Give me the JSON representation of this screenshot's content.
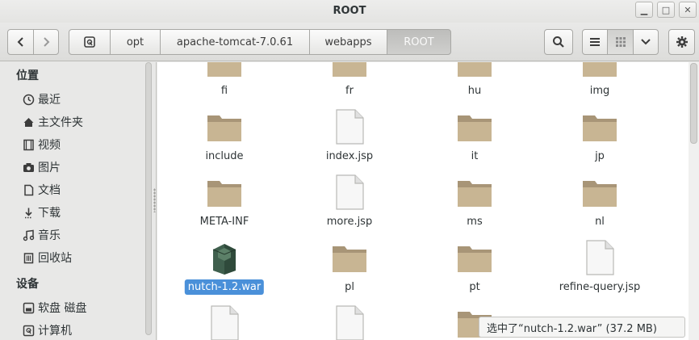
{
  "window": {
    "title": "ROOT",
    "buttons": [
      "minimize",
      "maximize",
      "close"
    ]
  },
  "toolbar": {
    "back_icon": "chevron-left-icon",
    "forward_icon": "chevron-right-icon",
    "breadcrumb": [
      "opt",
      "apache-tomcat-7.0.61",
      "webapps",
      "ROOT"
    ],
    "search_icon": "search-icon",
    "view_list_icon": "list-view-icon",
    "view_grid_icon": "grid-view-icon",
    "menu_icon": "chevron-down-icon",
    "settings_icon": "gear-icon"
  },
  "sidebar": {
    "places_heading": "位置",
    "places": [
      {
        "label": "最近",
        "icon": "clock-icon"
      },
      {
        "label": "主文件夹",
        "icon": "home-icon"
      },
      {
        "label": "视频",
        "icon": "film-icon"
      },
      {
        "label": "图片",
        "icon": "camera-icon"
      },
      {
        "label": "文档",
        "icon": "document-icon"
      },
      {
        "label": "下载",
        "icon": "download-icon"
      },
      {
        "label": "音乐",
        "icon": "music-icon"
      },
      {
        "label": "回收站",
        "icon": "trash-icon"
      }
    ],
    "devices_heading": "设备",
    "devices": [
      {
        "label": "软盘 磁盘",
        "icon": "floppy-icon"
      },
      {
        "label": "计算机",
        "icon": "computer-icon"
      }
    ]
  },
  "files": [
    {
      "name": "fi",
      "type": "folder"
    },
    {
      "name": "fr",
      "type": "folder"
    },
    {
      "name": "hu",
      "type": "folder"
    },
    {
      "name": "img",
      "type": "folder"
    },
    {
      "name": "include",
      "type": "folder"
    },
    {
      "name": "index.jsp",
      "type": "file"
    },
    {
      "name": "it",
      "type": "folder"
    },
    {
      "name": "jp",
      "type": "folder"
    },
    {
      "name": "META-INF",
      "type": "folder"
    },
    {
      "name": "more.jsp",
      "type": "file"
    },
    {
      "name": "ms",
      "type": "folder"
    },
    {
      "name": "nl",
      "type": "folder"
    },
    {
      "name": "nutch-1.2.war",
      "type": "archive",
      "selected": true
    },
    {
      "name": "pl",
      "type": "folder"
    },
    {
      "name": "pt",
      "type": "folder"
    },
    {
      "name": "refine-query.jsp",
      "type": "file"
    }
  ],
  "status": "选中了“nutch-1.2.war” (37.2 MB)",
  "colors": {
    "selection": "#4a90d9",
    "folder": "#c8b593",
    "folder_dark": "#a89577"
  }
}
